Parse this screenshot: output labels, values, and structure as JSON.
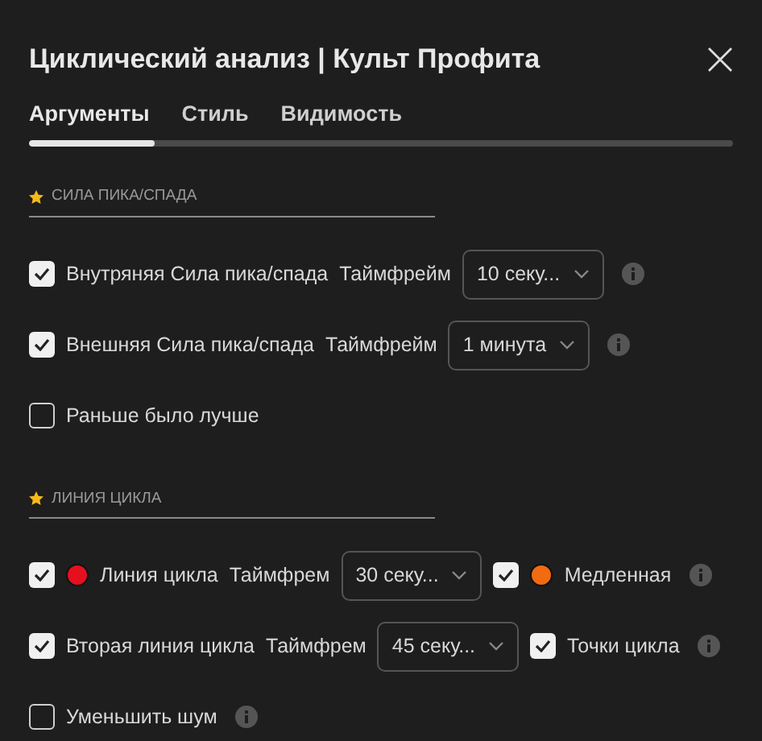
{
  "window": {
    "title": "Циклический анализ | Культ Профита"
  },
  "tabs": [
    {
      "label": "Аргументы",
      "selected": true
    },
    {
      "label": "Стиль",
      "selected": false
    },
    {
      "label": "Видимость",
      "selected": false
    }
  ],
  "sections": [
    {
      "title": "СИЛА ПИКА/СПАДА",
      "rows": [
        {
          "items": [
            {
              "kind": "checkbox",
              "checked": true,
              "label": "Внутряняя Сила пика/спада"
            },
            {
              "kind": "label",
              "text": "Таймфрейм"
            },
            {
              "kind": "select",
              "value": "10 секу..."
            },
            {
              "kind": "info"
            }
          ]
        },
        {
          "items": [
            {
              "kind": "checkbox",
              "checked": true,
              "label": "Внешняя Сила пика/спада"
            },
            {
              "kind": "label",
              "text": "Таймфрейм"
            },
            {
              "kind": "select",
              "value": "1 минута"
            },
            {
              "kind": "info"
            }
          ]
        },
        {
          "items": [
            {
              "kind": "checkbox",
              "checked": false,
              "label": "Раньше было лучше"
            }
          ]
        }
      ]
    },
    {
      "title": "ЛИНИЯ ЦИКЛА",
      "rows": [
        {
          "items": [
            {
              "kind": "checkbox",
              "checked": true,
              "label": "Линия цикла",
              "color": "#e4101f"
            },
            {
              "kind": "label",
              "text": "Таймфрем"
            },
            {
              "kind": "select",
              "value": "30 секу..."
            },
            {
              "kind": "checkbox",
              "checked": true,
              "label": "Медленная",
              "color": "#f26b10"
            },
            {
              "kind": "info"
            }
          ]
        },
        {
          "items": [
            {
              "kind": "checkbox",
              "checked": true,
              "label": "Вторая линия цикла"
            },
            {
              "kind": "label",
              "text": "Таймфрем"
            },
            {
              "kind": "select",
              "value": "45 секу..."
            },
            {
              "kind": "checkbox",
              "checked": true,
              "label": "Точки цикла"
            },
            {
              "kind": "info"
            }
          ]
        },
        {
          "items": [
            {
              "kind": "checkbox",
              "checked": false,
              "label": "Уменьшить шум"
            },
            {
              "kind": "info"
            }
          ]
        }
      ]
    }
  ]
}
